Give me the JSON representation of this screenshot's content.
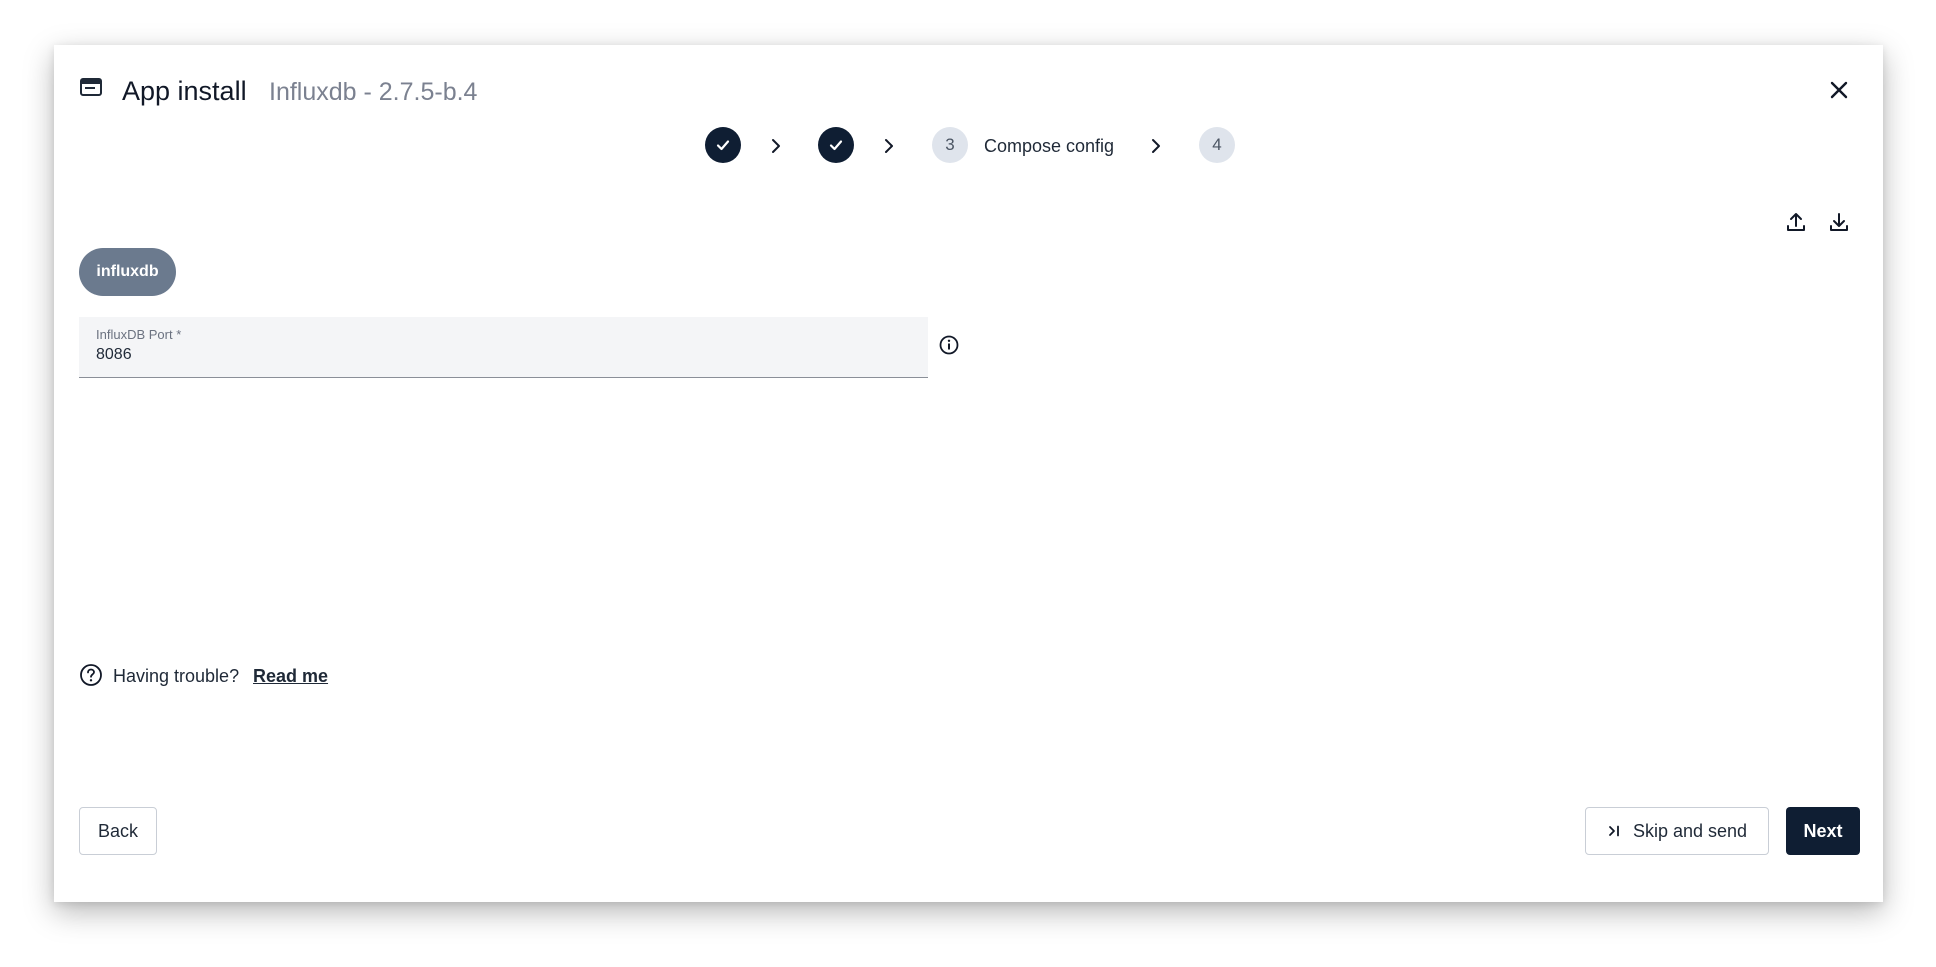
{
  "header": {
    "title": "App install",
    "subtitle": "Influxdb - 2.7.5-b.4"
  },
  "stepper": {
    "steps": [
      {
        "state": "done"
      },
      {
        "state": "done"
      },
      {
        "number": "3",
        "label": "Compose config",
        "state": "current"
      },
      {
        "number": "4",
        "state": "todo"
      }
    ]
  },
  "toolbar": {
    "upload_icon": "upload-icon",
    "download_icon": "download-icon"
  },
  "service_chip": "influxdb",
  "form": {
    "port": {
      "label": "InfluxDB Port *",
      "value": "8086"
    }
  },
  "help": {
    "text": "Having trouble?",
    "link": "Read me"
  },
  "footer": {
    "back": "Back",
    "skip": "Skip and send",
    "next": "Next"
  },
  "colors": {
    "primary": "#0f1e33",
    "chip": "#6b7a8e",
    "step_todo": "#dfe4ec"
  }
}
